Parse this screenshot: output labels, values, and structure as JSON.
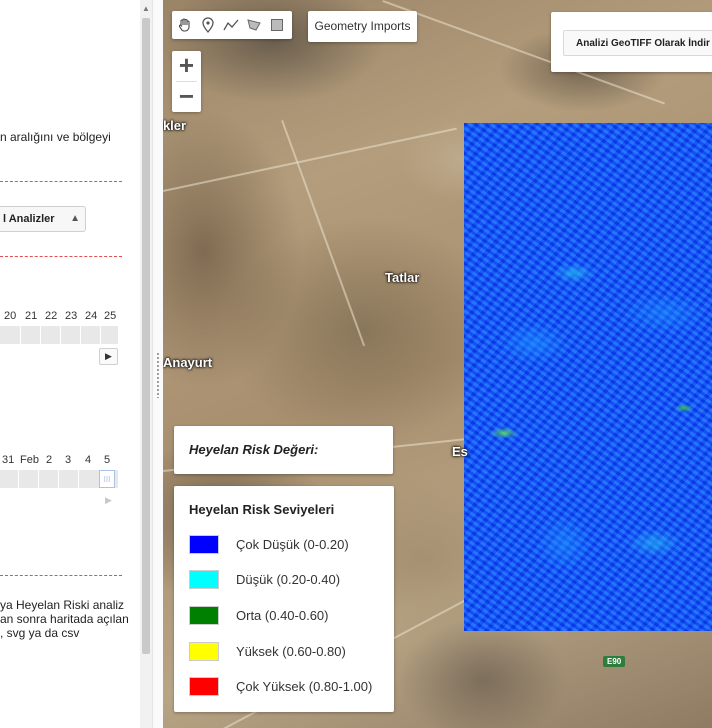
{
  "left_panel": {
    "intro_text": "n aralığını ve bölgeyi",
    "analysis_select_value": "l Analizler",
    "timeline_top": {
      "labels": [
        "20",
        "21",
        "22",
        "23",
        "24",
        "25"
      ],
      "play_label": "▶"
    },
    "timeline_bottom": {
      "labels": [
        "31",
        "Feb",
        "2",
        "3",
        "4",
        "5"
      ],
      "play_label": "▶",
      "knob_label": "III"
    },
    "footer_text": [
      "ya Heyelan Riski analiz",
      "an sonra haritada açılan",
      ", svg ya da csv"
    ]
  },
  "map": {
    "toolbar": {
      "geometry_imports_label": "Geometry Imports",
      "download_label": "Analizi GeoTIFF Olarak İndir"
    },
    "zoom": {
      "in_label": "+",
      "out_label": "−"
    },
    "place_labels": {
      "okler": "ökler",
      "tatlar": "Tatlar",
      "anayurt": "Anayurt",
      "es": "Es"
    },
    "road_shield": "E90",
    "risk_value_title": "Heyelan Risk Değeri:",
    "legend": {
      "title": "Heyelan Risk Seviyeleri",
      "items": [
        {
          "color": "#0000ff",
          "label": "Çok Düşük (0-0.20)"
        },
        {
          "color": "#00ffff",
          "label": "Düşük (0.20-0.40)"
        },
        {
          "color": "#008000",
          "label": "Orta (0.40-0.60)"
        },
        {
          "color": "#ffff00",
          "label": "Yüksek (0.60-0.80)"
        },
        {
          "color": "#ff0000",
          "label": "Çok Yüksek (0.80-1.00)"
        }
      ]
    }
  },
  "icons": [
    "hand-icon",
    "marker-icon",
    "line-icon",
    "polygon-icon",
    "rectangle-icon"
  ]
}
